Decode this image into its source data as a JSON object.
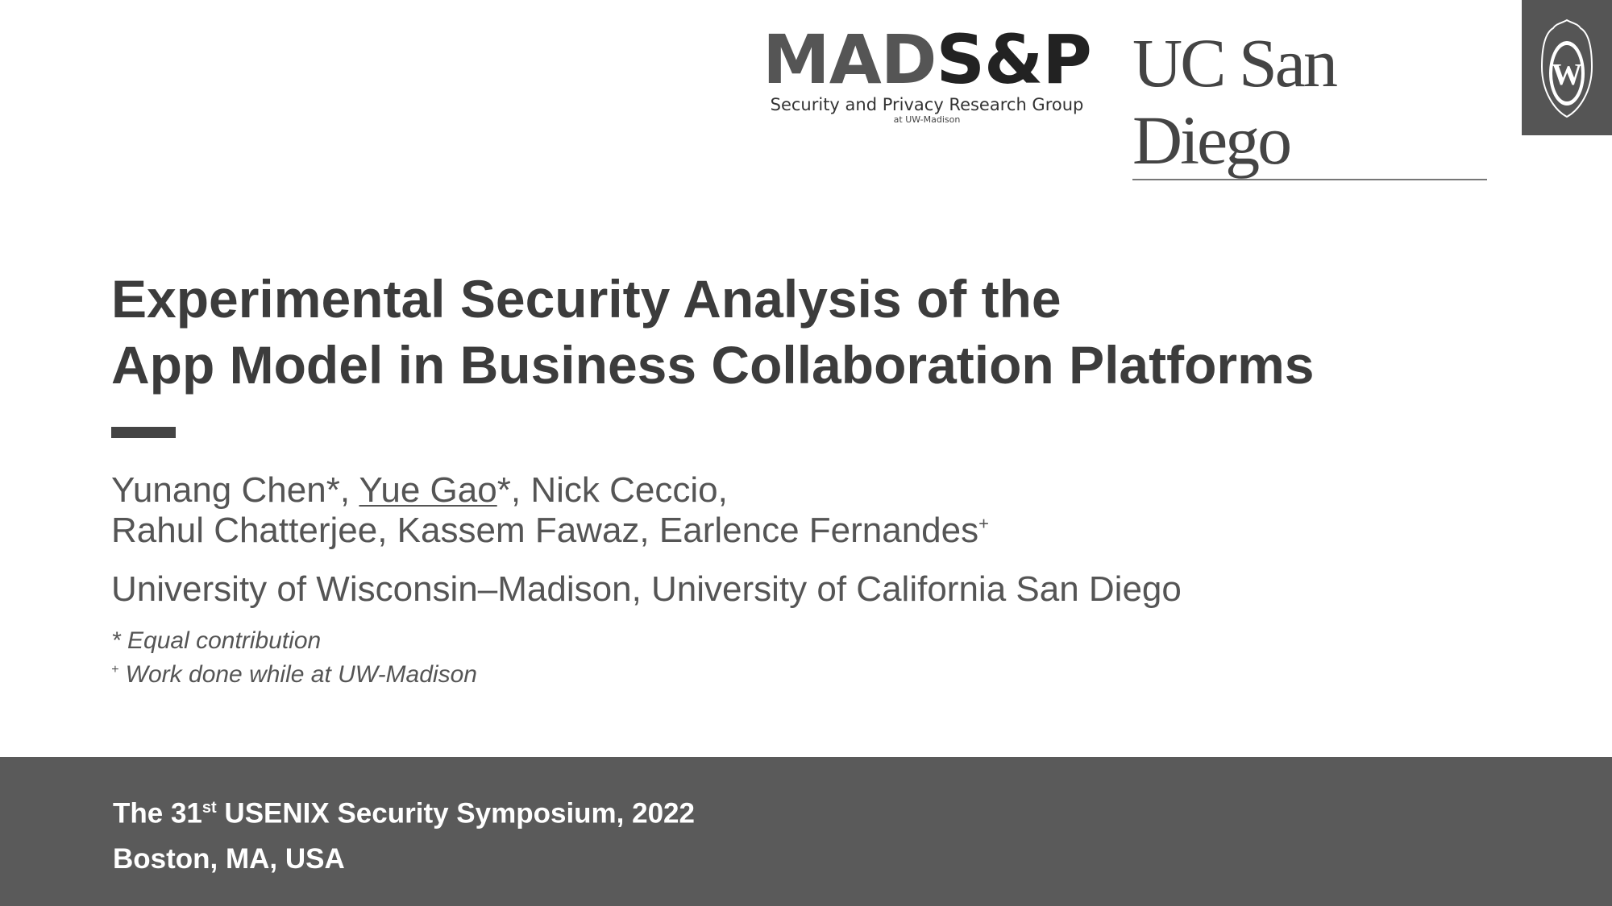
{
  "logos": {
    "mads": {
      "main_light": "MAD",
      "main_dark": "S&P",
      "subtitle": "Security and Privacy Research Group",
      "subtitle2": "at UW-Madison"
    },
    "ucsd": {
      "text": "UC San Diego"
    },
    "uw": {
      "letter": "W"
    }
  },
  "title": {
    "line1": "Experimental Security Analysis of the",
    "line2": "App Model in Business Collaboration Platforms"
  },
  "authors": {
    "line1": [
      {
        "name": "Yunang Chen",
        "mark": "*"
      },
      {
        "name": "Yue Gao",
        "mark": "*",
        "underlined": true
      },
      {
        "name": "Nick Ceccio"
      }
    ],
    "line2": [
      {
        "name": "Rahul Chatterjee"
      },
      {
        "name": "Kassem Fawaz"
      },
      {
        "name": "Earlence Fernandes",
        "mark": "+"
      }
    ],
    "sep": ", ",
    "trail": ","
  },
  "affiliation": "University of Wisconsin–Madison, University of California San Diego",
  "notes": [
    {
      "mark": "*",
      "text": " Equal contribution"
    },
    {
      "mark": "+",
      "text": " Work done while at UW-Madison"
    }
  ],
  "footer": {
    "venue_prefix": "The 31",
    "venue_sup": "st",
    "venue_suffix": " USENIX Security Symposium, 2022",
    "place": "Boston, MA, USA"
  }
}
